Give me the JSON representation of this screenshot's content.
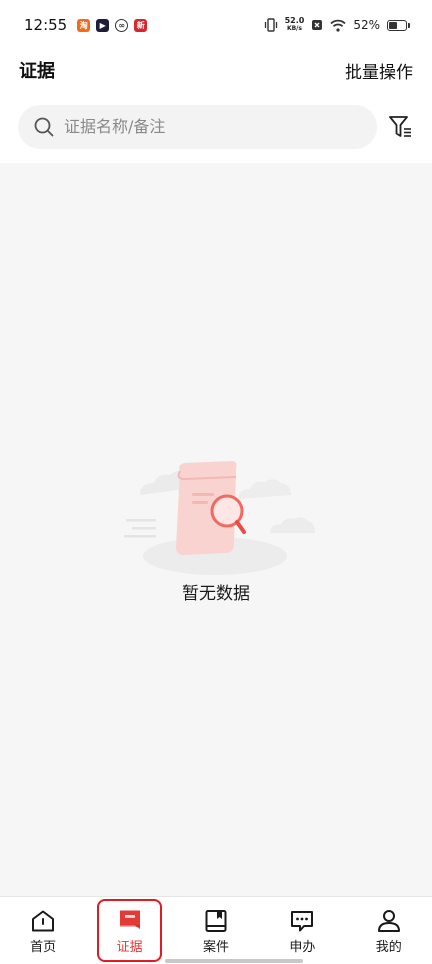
{
  "status_bar": {
    "time": "12:55",
    "net_speed_value": "52.0",
    "net_speed_unit": "KB/s",
    "battery": "52%",
    "battery_level": 0.52
  },
  "header": {
    "title": "证据",
    "batch_action": "批量操作"
  },
  "search": {
    "placeholder": "证据名称/备注",
    "value": ""
  },
  "empty_state": {
    "text": "暂无数据"
  },
  "bottom_nav": {
    "items": [
      {
        "label": "首页",
        "icon": "home-icon"
      },
      {
        "label": "证据",
        "icon": "evidence-flag-icon",
        "active": true
      },
      {
        "label": "案件",
        "icon": "case-icon"
      },
      {
        "label": "申办",
        "icon": "chat-icon"
      },
      {
        "label": "我的",
        "icon": "user-icon"
      }
    ]
  },
  "colors": {
    "accent": "#e53935",
    "background": "#f6f6f6",
    "search_bg": "#f3f3f3"
  }
}
